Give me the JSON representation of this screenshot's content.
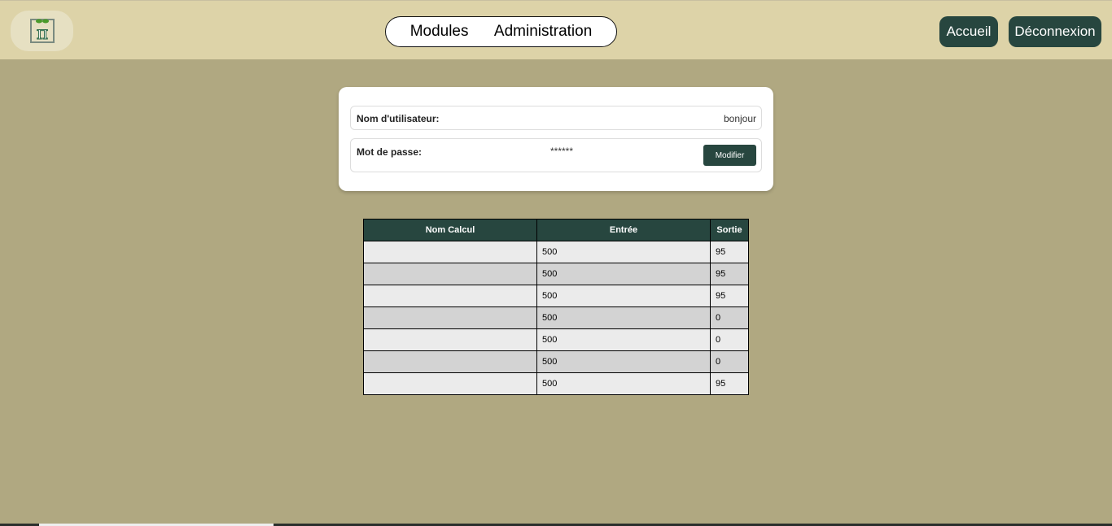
{
  "nav": {
    "modules": "Modules",
    "administration": "Administration"
  },
  "buttons": {
    "home": "Accueil",
    "logout": "Déconnexion",
    "modify": "Modifier"
  },
  "account": {
    "username_label": "Nom d'utilisateur:",
    "username": "bonjour",
    "password_label": "Mot de passe:",
    "password": "******"
  },
  "table": {
    "headers": [
      "Nom Calcul",
      "Entrée",
      "Sortie"
    ],
    "rows": [
      [
        "",
        "500",
        "95"
      ],
      [
        "",
        "500",
        "95"
      ],
      [
        "",
        "500",
        "95"
      ],
      [
        "",
        "500",
        "0"
      ],
      [
        "",
        "500",
        "0"
      ],
      [
        "",
        "500",
        "0"
      ],
      [
        "",
        "500",
        "95"
      ]
    ]
  }
}
